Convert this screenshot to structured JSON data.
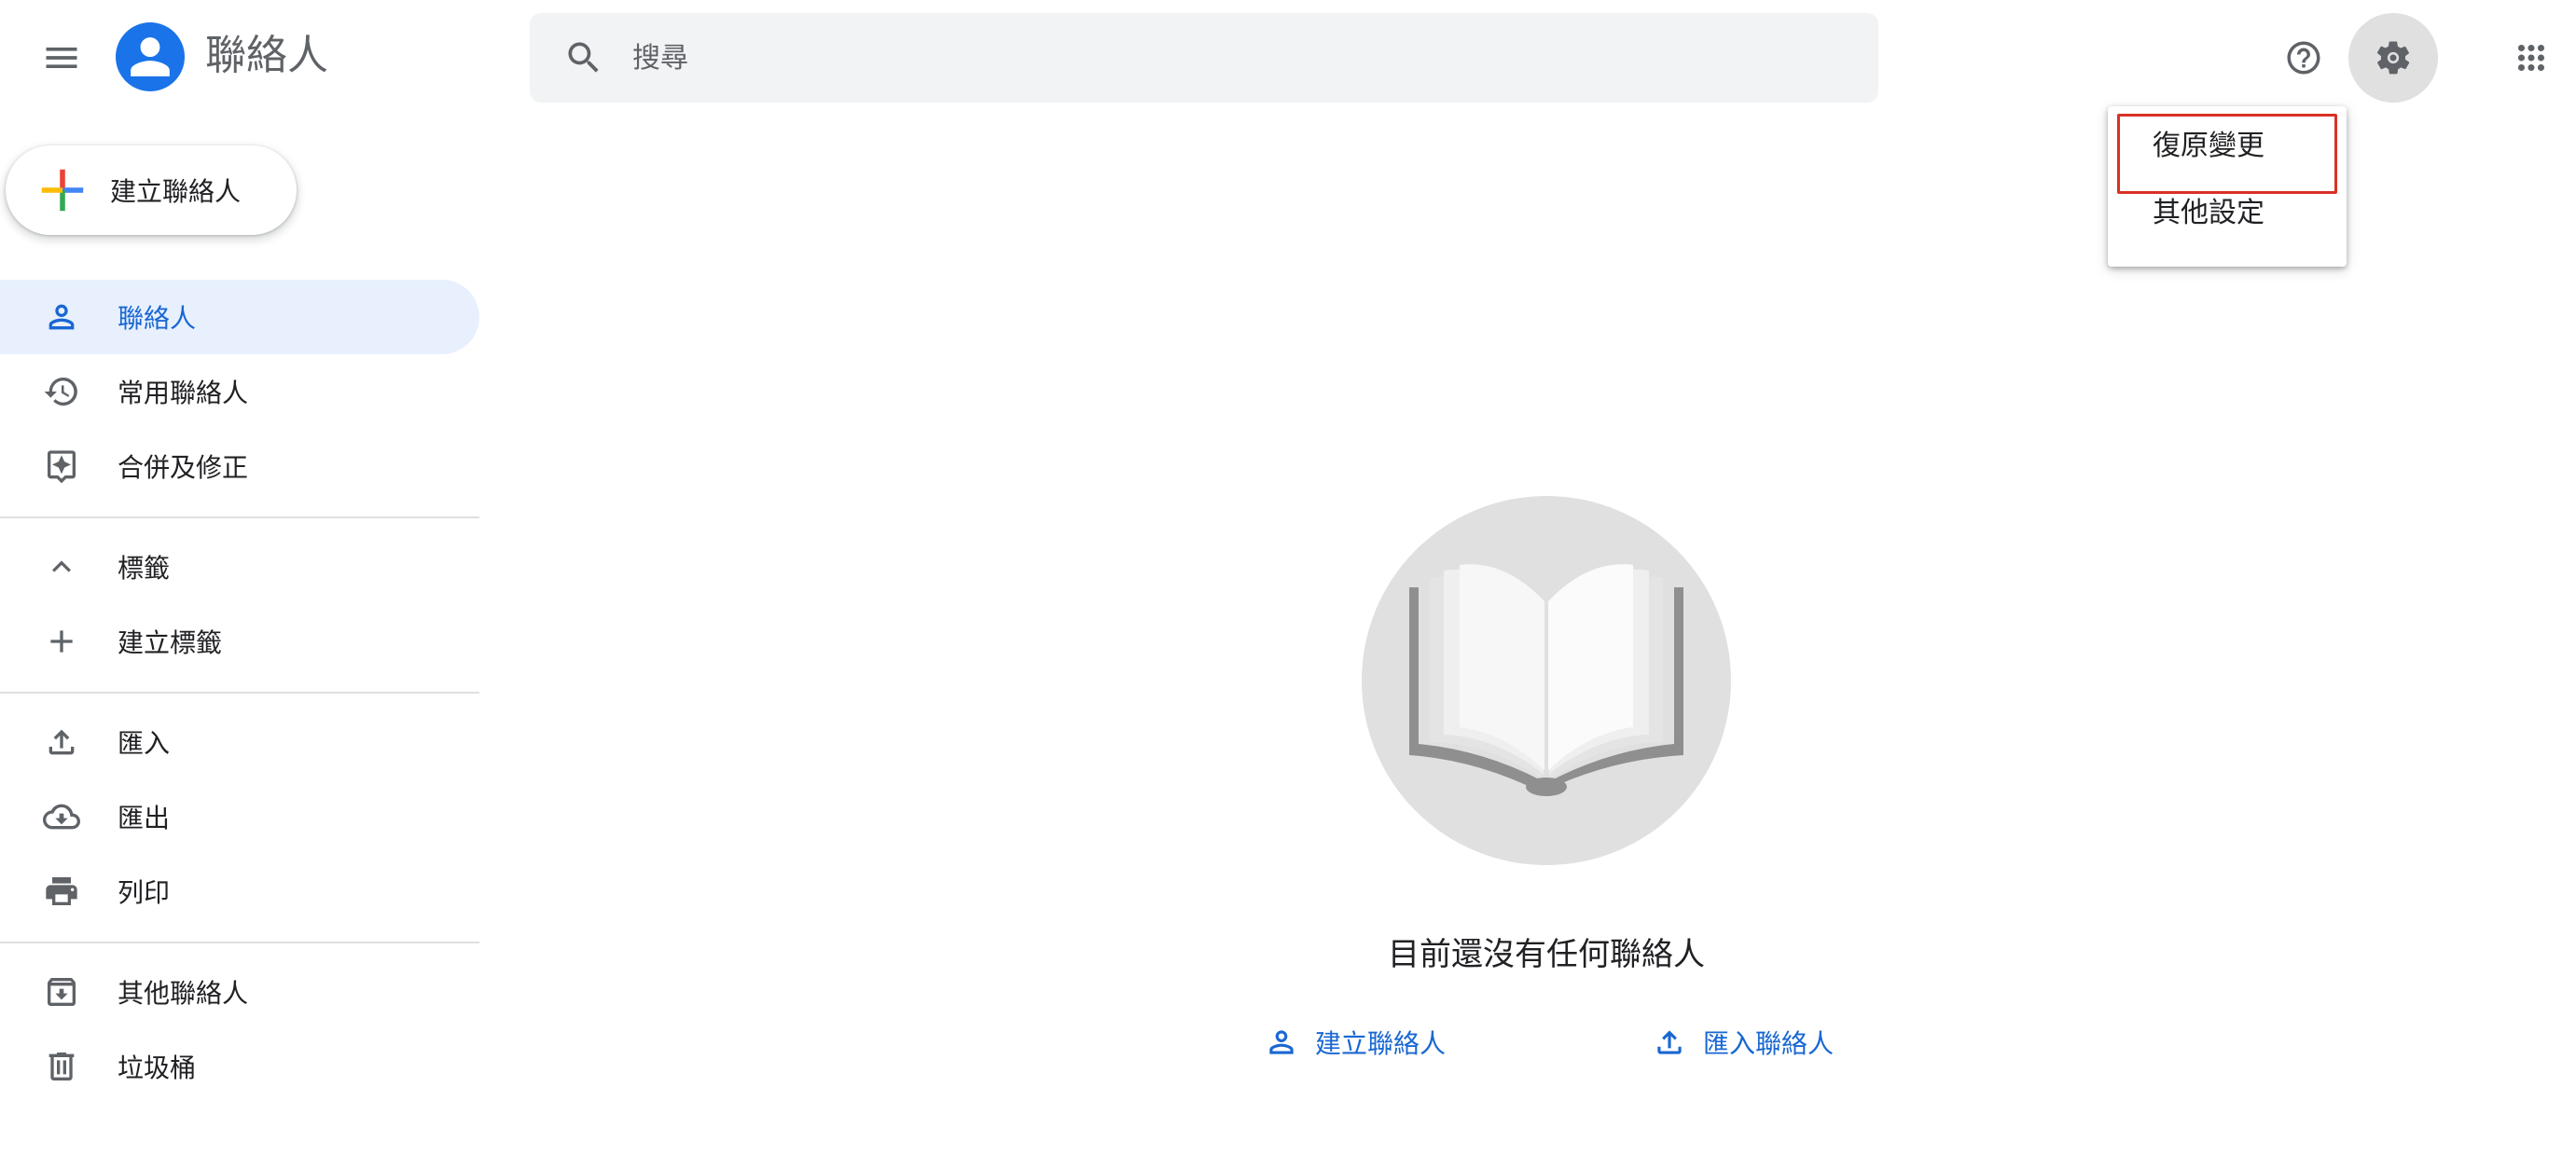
{
  "header": {
    "app_title": "聯絡人",
    "search": {
      "placeholder": "搜尋",
      "value": ""
    }
  },
  "settings_menu": {
    "items": [
      {
        "label": "復原變更",
        "highlighted": true
      },
      {
        "label": "其他設定",
        "highlighted": false
      }
    ],
    "highlight_color": "#d93025"
  },
  "create_button": {
    "label": "建立聯絡人"
  },
  "sidebar": {
    "items": [
      {
        "label": "聯絡人",
        "icon": "person-icon",
        "active": true
      },
      {
        "label": "常用聯絡人",
        "icon": "history-icon",
        "active": false
      },
      {
        "label": "合併及修正",
        "icon": "merge-fix-icon",
        "active": false
      },
      {
        "label": "標籤",
        "icon": "chevron-up-icon",
        "active": false
      },
      {
        "label": "建立標籤",
        "icon": "plus-icon",
        "active": false
      },
      {
        "label": "匯入",
        "icon": "upload-icon",
        "active": false
      },
      {
        "label": "匯出",
        "icon": "cloud-download-icon",
        "active": false
      },
      {
        "label": "列印",
        "icon": "printer-icon",
        "active": false
      },
      {
        "label": "其他聯絡人",
        "icon": "archive-icon",
        "active": false
      },
      {
        "label": "垃圾桶",
        "icon": "trash-icon",
        "active": false
      }
    ]
  },
  "empty_state": {
    "message": "目前還沒有任何聯絡人",
    "actions": [
      {
        "label": "建立聯絡人",
        "icon": "person-icon"
      },
      {
        "label": "匯入聯絡人",
        "icon": "upload-icon"
      }
    ]
  },
  "colors": {
    "accent": "#1a73e8",
    "active_text": "#1967d2",
    "active_bg": "#e8f0fe",
    "icon_gray": "#5f6368"
  }
}
